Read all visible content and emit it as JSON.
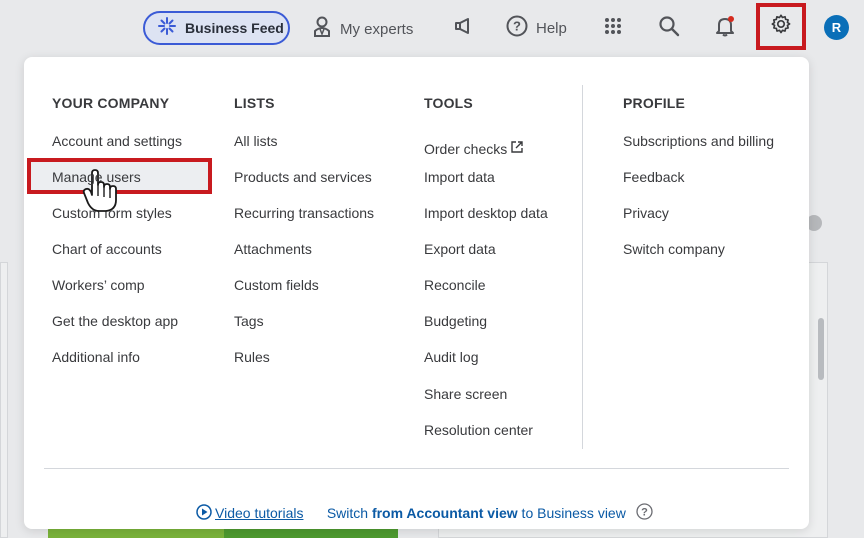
{
  "topbar": {
    "business_feed_label": "Business Feed",
    "my_experts_label": "My experts",
    "help_label": "Help",
    "avatar_initial": "R"
  },
  "menu": {
    "columns": [
      {
        "heading": "YOUR COMPANY",
        "items": [
          "Account and settings",
          "Manage users",
          "Custom form styles",
          "Chart of accounts",
          "Workers’ comp",
          "Get the desktop app",
          "Additional info"
        ]
      },
      {
        "heading": "LISTS",
        "items": [
          "All lists",
          "Products and services",
          "Recurring transactions",
          "Attachments",
          "Custom fields",
          "Tags",
          "Rules"
        ]
      },
      {
        "heading": "TOOLS",
        "items": [
          "Order checks",
          "Import data",
          "Import desktop data",
          "Export data",
          "Reconcile",
          "Budgeting",
          "Audit log",
          "Share screen",
          "Resolution center"
        ]
      },
      {
        "heading": "PROFILE",
        "items": [
          "Subscriptions and billing",
          "Feedback",
          "Privacy",
          "Switch company"
        ]
      }
    ],
    "footer": {
      "video_tutorials": "Video tutorials",
      "switch_prefix": "Switch ",
      "switch_bold": "from Accountant view",
      "switch_suffix": " to Business view"
    }
  },
  "colors": {
    "highlight_border": "#c81a1f",
    "link_blue": "#0b5aa5",
    "accent": "#3b5bd6"
  }
}
